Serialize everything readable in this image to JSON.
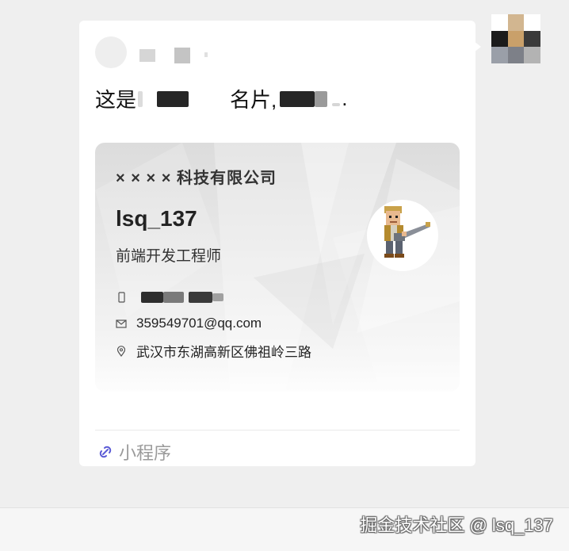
{
  "chat": {
    "message_prefix": "这是",
    "message_middle": "名片,",
    "message_end": "."
  },
  "card": {
    "company": "× × × × 科技有限公司",
    "name": "lsq_137",
    "job_title": "前端开发工程师",
    "phone_icon": "phone-icon",
    "email_icon": "mail-icon",
    "email": "359549701@qq.com",
    "address_icon": "location-pin-icon",
    "address": "武汉市东湖高新区佛祖岭三路"
  },
  "mini_program": {
    "icon": "link-icon",
    "label": "小程序"
  },
  "watermark": "掘金技术社区 @ lsq_137",
  "colors": {
    "background": "#efefef",
    "bubble": "#ffffff",
    "mini_program_icon": "#5b5bd6"
  }
}
